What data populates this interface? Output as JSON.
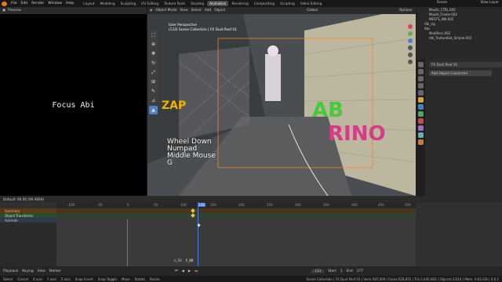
{
  "topbar": {
    "menus": [
      "File",
      "Edit",
      "Render",
      "Window",
      "Help"
    ],
    "workspaces": [
      "Layout",
      "Modeling",
      "Sculpting",
      "UV Editing",
      "Texture Paint",
      "Shading",
      "Animation",
      "Rendering",
      "Compositing",
      "Scripting",
      "Video Editing"
    ],
    "active_workspace": "Animation",
    "scene": "Scene",
    "view_layer": "View Layer"
  },
  "preview": {
    "header": "Preview",
    "focus_text": "Focus Abi"
  },
  "viewport": {
    "mode": "Object Mode",
    "menus": [
      "View",
      "Select",
      "Add",
      "Object"
    ],
    "orientation": "Global",
    "options": "Options",
    "perspective": "User Perspective",
    "collection_info": "(133) Scene Collection | FX Dust Poof 01",
    "key_hints": [
      "Wheel Down",
      "Numpad",
      "Middle Mouse",
      "G"
    ]
  },
  "outliner": {
    "items": [
      "Mouth_CTRL.002",
      "Mouth_Frame.002",
      "MESTS_ANI.002",
      "Abi_rig",
      "Sbs",
      "Modifiers.002",
      "Abi_TextureSet_Simple.002"
    ]
  },
  "properties": {
    "object_name": "FX Dust Poof 01",
    "constraint": "Add Object Constraint"
  },
  "timeline": {
    "header": "Default: 96.00 (96-4069)",
    "current_frame": "133",
    "channels": [
      "Summary",
      "Object Transforms",
      "Animate"
    ],
    "ticks": [
      "-100",
      "-50",
      "0",
      "50",
      "100",
      "133",
      "150",
      "200",
      "250",
      "300",
      "350",
      "400",
      "450",
      "500"
    ],
    "marker": "F_90",
    "scale": "n_50"
  },
  "playback": {
    "labels": [
      "Playback",
      "Keying",
      "View",
      "Marker"
    ],
    "frame": "133",
    "start_label": "Start",
    "start": "1",
    "end_label": "End",
    "end": "377"
  },
  "status": {
    "items": [
      "Select",
      "Cancel",
      "X axis",
      "Y axis",
      "Z axis",
      "Snap Invert",
      "Snap Toggle",
      "Move",
      "Rotate",
      "Resize"
    ],
    "info": "Scene Collection | FX Dust Poof 01 | Verts:587,009 | Faces:528,655 | Tris:1,045,602 | Objects:1/314 | Mem: 4.63 GiB | 3.0.1"
  }
}
